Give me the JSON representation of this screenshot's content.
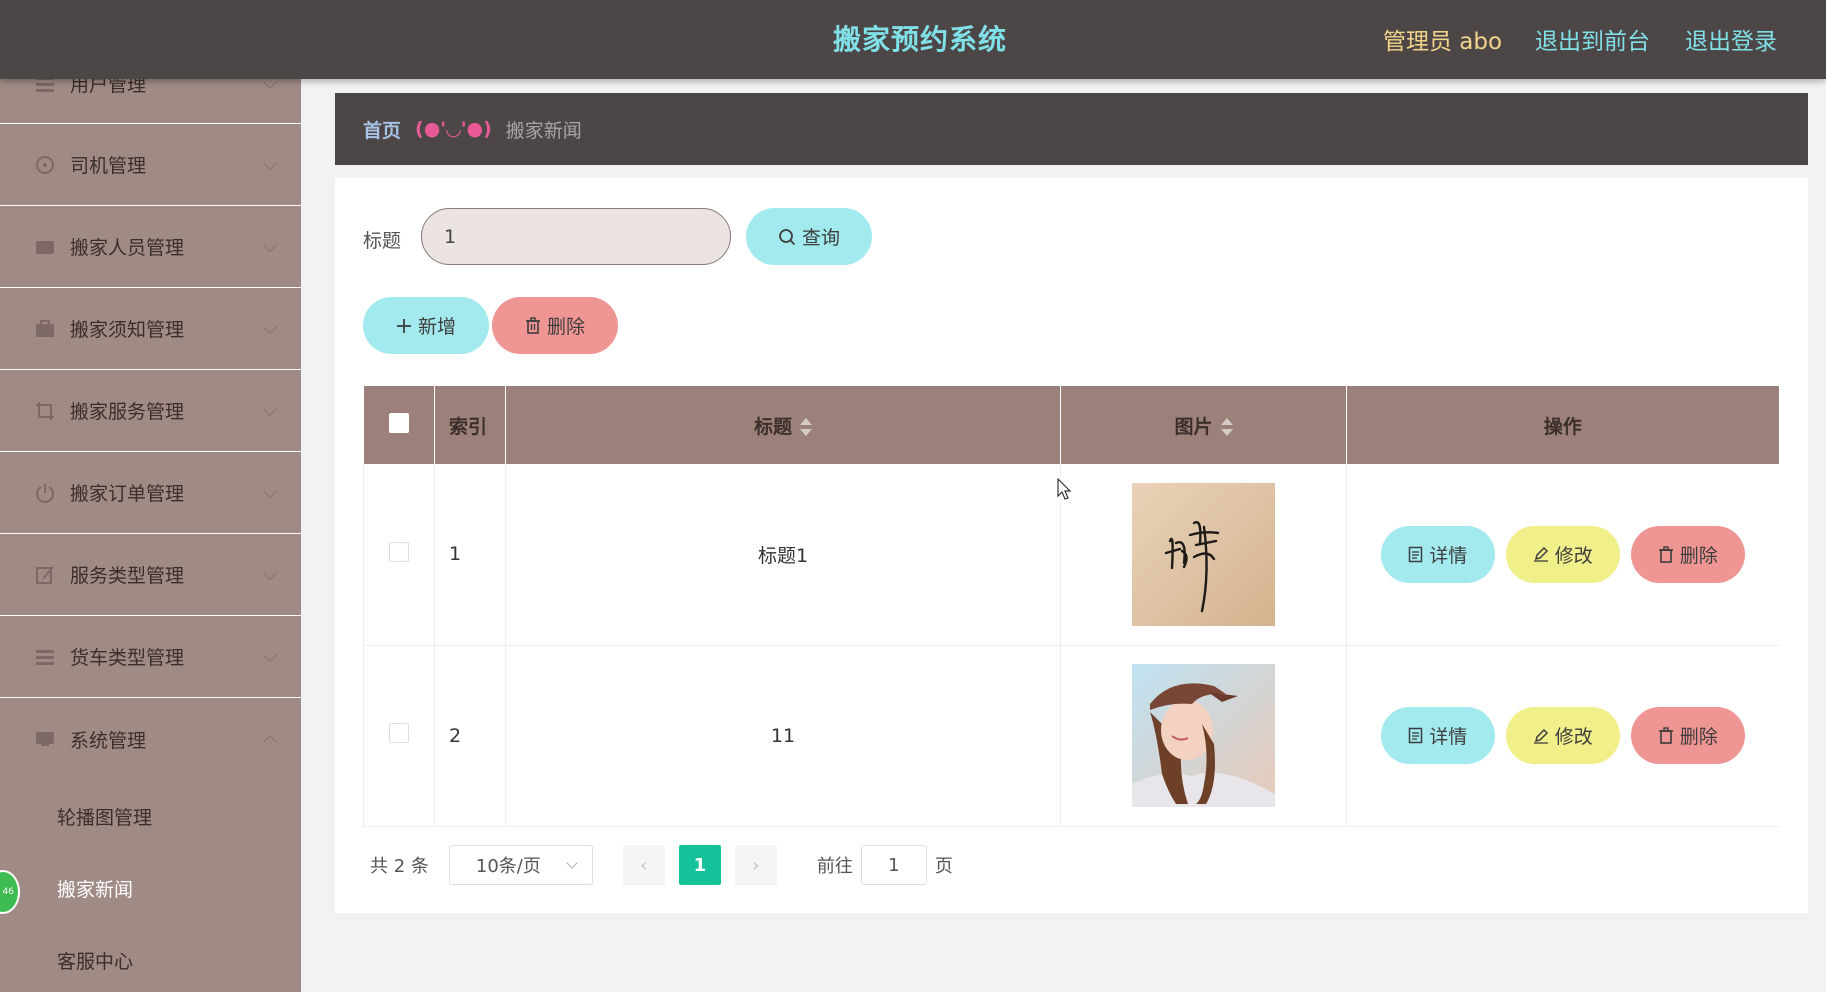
{
  "header": {
    "title": "搬家预约系统",
    "admin": "管理员 abo",
    "to_front": "退出到前台",
    "logout": "退出登录"
  },
  "sidebar": {
    "items": [
      {
        "label": "用户管理",
        "icon": "users-icon"
      },
      {
        "label": "司机管理",
        "icon": "driver-icon"
      },
      {
        "label": "搬家人员管理",
        "icon": "staff-icon"
      },
      {
        "label": "搬家须知管理",
        "icon": "notice-icon"
      },
      {
        "label": "搬家服务管理",
        "icon": "service-icon"
      },
      {
        "label": "搬家订单管理",
        "icon": "order-icon"
      },
      {
        "label": "服务类型管理",
        "icon": "type-icon"
      },
      {
        "label": "货车类型管理",
        "icon": "truck-icon"
      },
      {
        "label": "系统管理",
        "icon": "system-icon"
      }
    ],
    "sub_items": [
      {
        "label": "轮播图管理"
      },
      {
        "label": "搬家新闻"
      },
      {
        "label": "客服中心"
      }
    ],
    "badge": "46"
  },
  "breadcrumb": {
    "home": "首页",
    "separator": "(●'◡'●)",
    "current": "搬家新闻"
  },
  "search": {
    "label": "标题",
    "value": "1",
    "query_button": "查询"
  },
  "actions": {
    "add": "新增",
    "delete": "删除"
  },
  "table": {
    "headers": {
      "index": "索引",
      "title": "标题",
      "image": "图片",
      "ops": "操作"
    },
    "rows": [
      {
        "index": "1",
        "title": "标题1",
        "image": "signature-image"
      },
      {
        "index": "2",
        "title": "11",
        "image": "portrait-image"
      }
    ],
    "row_buttons": {
      "detail": "详情",
      "edit": "修改",
      "delete": "删除"
    }
  },
  "pager": {
    "total": "共 2 条",
    "page_size": "10条/页",
    "current_page": "1",
    "goto_label": "前往",
    "goto_value": "1",
    "page_suffix": "页"
  },
  "colors": {
    "header_bg": "#4d4647",
    "title_cyan": "#7fe0e7",
    "admin_yellow": "#f2d58a",
    "sidebar_bg": "#a08a85",
    "table_header_bg": "#9c807a",
    "btn_cyan": "#a3eaee",
    "btn_red": "#ef9594",
    "btn_yellow": "#f1ef8a",
    "pager_active": "#15c39a"
  }
}
